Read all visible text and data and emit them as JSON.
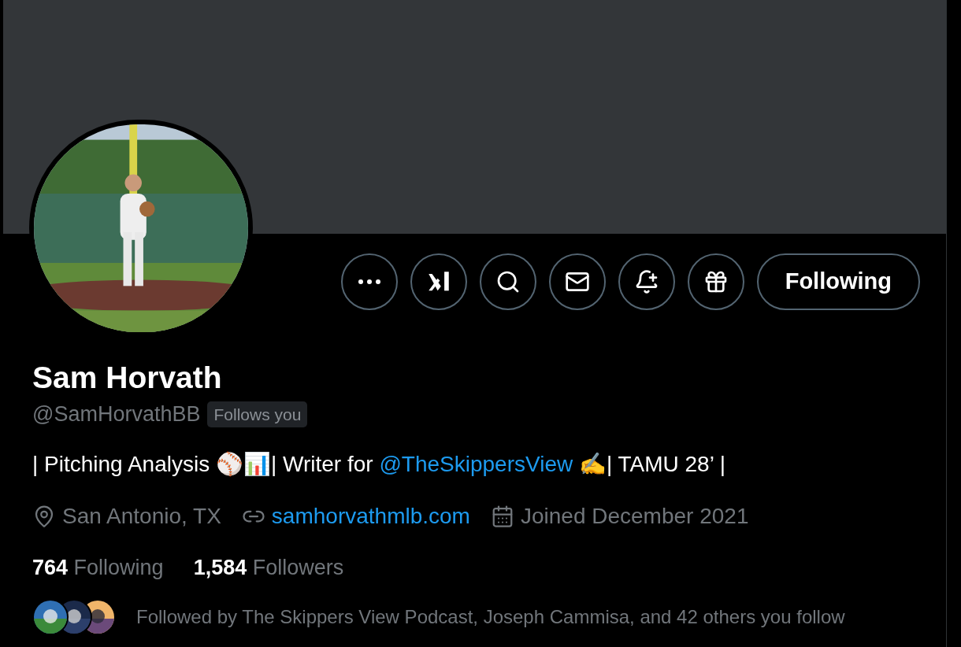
{
  "banner": {
    "kind": "plain"
  },
  "actions": [
    {
      "kind": "more"
    },
    {
      "kind": "grok"
    },
    {
      "kind": "search"
    },
    {
      "kind": "message"
    },
    {
      "kind": "notify"
    },
    {
      "kind": "gift"
    }
  ],
  "follow_button": {
    "label": "Following"
  },
  "profile": {
    "name": "Sam Horvath",
    "handle": "@SamHorvathBB",
    "badge": "Follows you",
    "bio": [
      {
        "kind": "text",
        "text": "| Pitching Analysis ⚾📊| Writer for "
      },
      {
        "kind": "mention",
        "text": "@TheSkippersView"
      },
      {
        "kind": "text",
        "text": " ✍️| TAMU 28’ |"
      }
    ],
    "meta": [
      {
        "kind": "location",
        "text": "San Antonio, TX"
      },
      {
        "kind": "link",
        "text": "samhorvathmlb.com"
      },
      {
        "kind": "joined",
        "text": "Joined December 2021"
      }
    ],
    "stats": [
      {
        "count": "764",
        "label": "Following"
      },
      {
        "count": "1,584",
        "label": "Followers"
      }
    ]
  },
  "followed_by": {
    "text": "Followed by The Skippers View Podcast, Joseph Cammisa, and 42 others you follow"
  }
}
